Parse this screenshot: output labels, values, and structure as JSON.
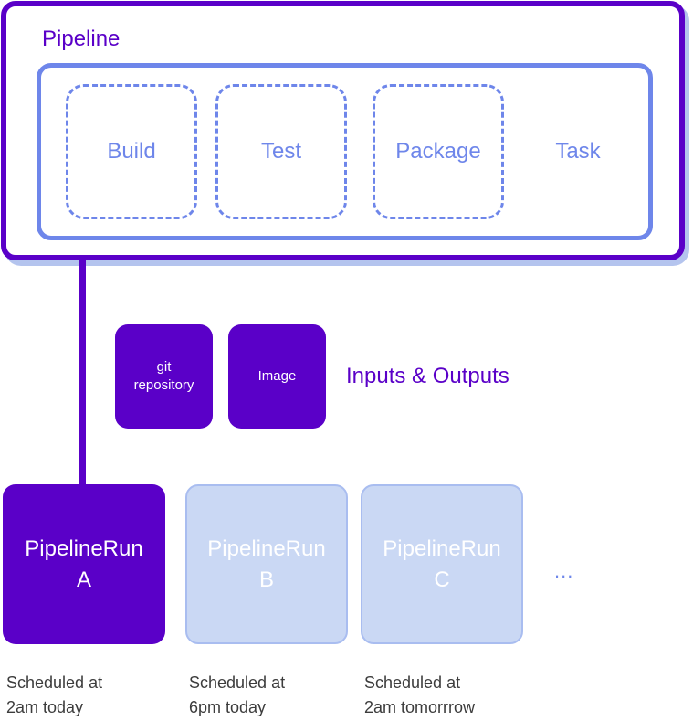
{
  "pipeline": {
    "title": "Pipeline",
    "tasks": [
      {
        "label": "Build",
        "style": "dashed"
      },
      {
        "label": "Test",
        "style": "dashed"
      },
      {
        "label": "Package",
        "style": "dashed"
      },
      {
        "label": "Task",
        "style": "plain"
      }
    ]
  },
  "resources": {
    "items": [
      {
        "line1": "git",
        "line2": "repository"
      },
      {
        "line1": "Image",
        "line2": ""
      }
    ],
    "label": "Inputs & Outputs"
  },
  "runs": [
    {
      "title": "PipelineRun",
      "letter": "A",
      "state": "active",
      "schedule_line1": "Scheduled at",
      "schedule_line2": "2am today"
    },
    {
      "title": "PipelineRun",
      "letter": "B",
      "state": "future",
      "schedule_line1": "Scheduled at",
      "schedule_line2": "6pm today"
    },
    {
      "title": "PipelineRun",
      "letter": "C",
      "state": "future",
      "schedule_line1": "Scheduled at",
      "schedule_line2": "2am tomorrrow"
    }
  ],
  "more_indicator": "...",
  "colors": {
    "primary_purple": "#5a00c8",
    "task_blue": "#6e86ea",
    "future_run_fill": "#cad8f4",
    "shadow_blue": "#b4c4ee",
    "schedule_text": "#3c3c3c"
  }
}
